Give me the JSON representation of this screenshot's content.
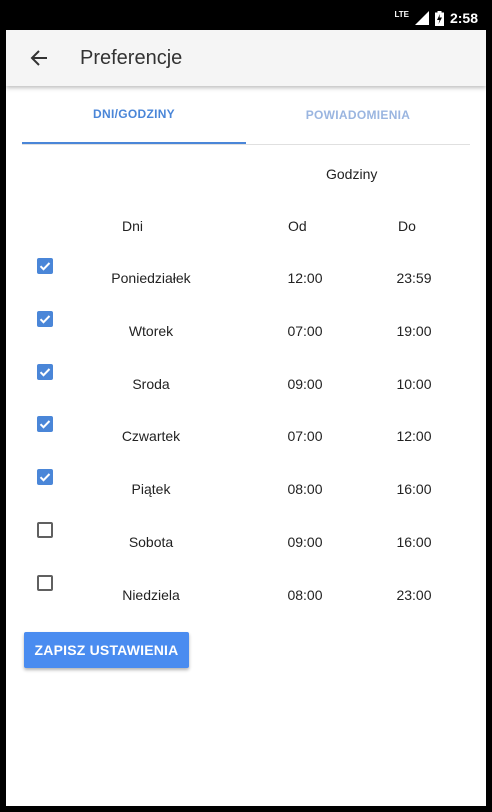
{
  "status": {
    "network": "LTE",
    "time": "2:58"
  },
  "appbar": {
    "title": "Preferencje"
  },
  "tabs": [
    {
      "label": "DNI/GODZINY",
      "active": true
    },
    {
      "label": "POWIADOMIENIA",
      "active": false
    }
  ],
  "table": {
    "group_header": "Godziny",
    "col_days": "Dni",
    "col_from": "Od",
    "col_to": "Do",
    "rows": [
      {
        "day": "Poniedziałek",
        "from": "12:00",
        "to": "23:59",
        "checked": true
      },
      {
        "day": "Wtorek",
        "from": "07:00",
        "to": "19:00",
        "checked": true
      },
      {
        "day": "Sroda",
        "from": "09:00",
        "to": "10:00",
        "checked": true
      },
      {
        "day": "Czwartek",
        "from": "07:00",
        "to": "12:00",
        "checked": true
      },
      {
        "day": "Piątek",
        "from": "08:00",
        "to": "16:00",
        "checked": true
      },
      {
        "day": "Sobota",
        "from": "09:00",
        "to": "16:00",
        "checked": false
      },
      {
        "day": "Niedziela",
        "from": "08:00",
        "to": "23:00",
        "checked": false
      }
    ]
  },
  "save_button": "ZAPISZ USTAWIENIA",
  "colors": {
    "accent": "#4a86d8",
    "button": "#4a8cf0"
  }
}
